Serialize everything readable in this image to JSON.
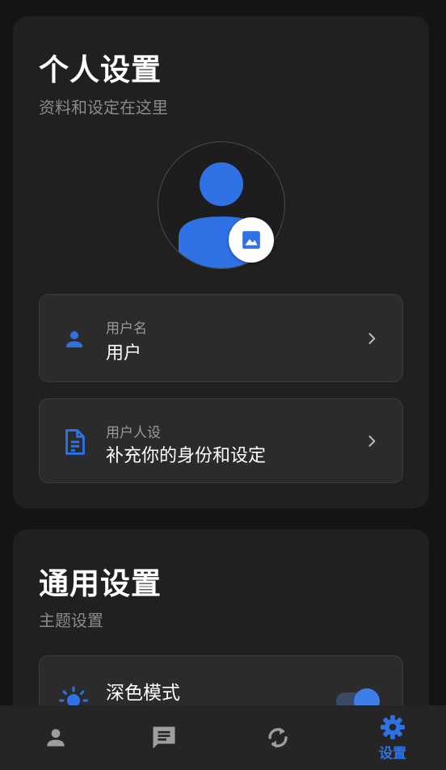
{
  "personal": {
    "title": "个人设置",
    "subtitle": "资料和设定在这里",
    "avatar_icon": "person-icon",
    "avatar_edit_icon": "image-icon",
    "username": {
      "label": "用户名",
      "value": "用户",
      "icon": "person-icon"
    },
    "persona": {
      "label": "用户人设",
      "value": "补充你的身份和设定",
      "icon": "document-icon"
    }
  },
  "general": {
    "title": "通用设置",
    "subtitle": "主题设置",
    "dark_mode": {
      "label": "深色模式",
      "enabled": true,
      "icon": "brightness-icon"
    }
  },
  "nav": {
    "items": [
      {
        "id": "profile",
        "icon": "person-icon",
        "label": ""
      },
      {
        "id": "chat",
        "icon": "chat-icon",
        "label": ""
      },
      {
        "id": "sync",
        "icon": "sync-icon",
        "label": ""
      },
      {
        "id": "settings",
        "icon": "gear-icon",
        "label": "设置",
        "active": true
      }
    ]
  },
  "colors": {
    "accent": "#2f72e6",
    "background": "#141414",
    "card": "#202020",
    "row": "#2b2b2b",
    "text_secondary": "#8a8a8a",
    "nav_inactive": "#9e9e9e"
  }
}
